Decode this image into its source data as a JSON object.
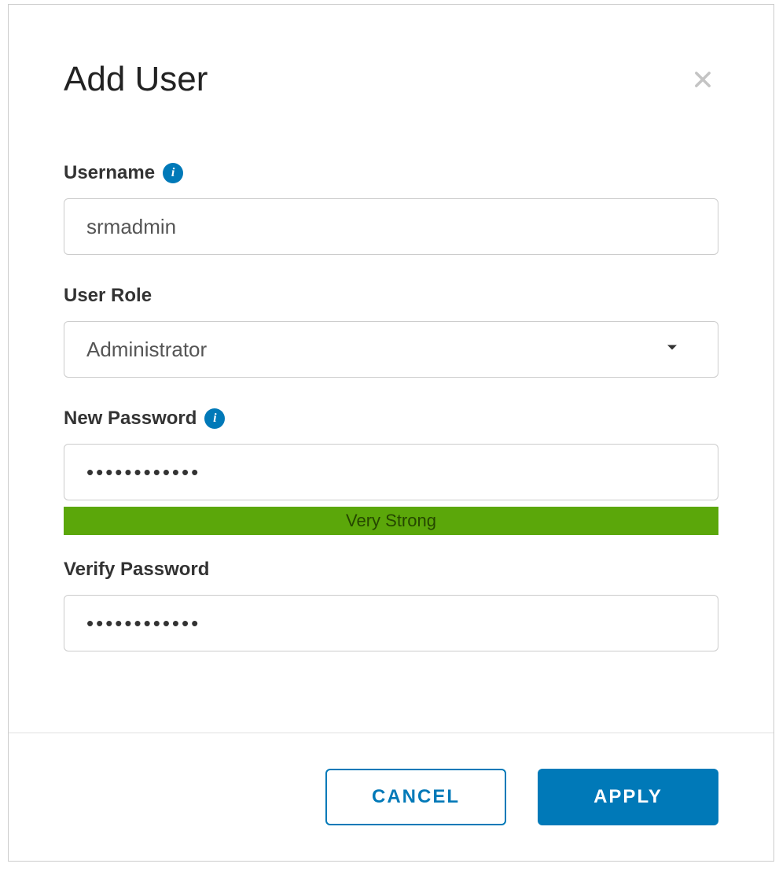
{
  "dialog": {
    "title": "Add User"
  },
  "fields": {
    "username": {
      "label": "Username",
      "value": "srmadmin"
    },
    "role": {
      "label": "User Role",
      "value": "Administrator"
    },
    "newPassword": {
      "label": "New Password",
      "value": "••••••••••••",
      "strengthText": "Very Strong",
      "strengthColor": "#5ba70a"
    },
    "verifyPassword": {
      "label": "Verify Password",
      "value": "••••••••••••"
    }
  },
  "buttons": {
    "cancel": "CANCEL",
    "apply": "APPLY"
  }
}
